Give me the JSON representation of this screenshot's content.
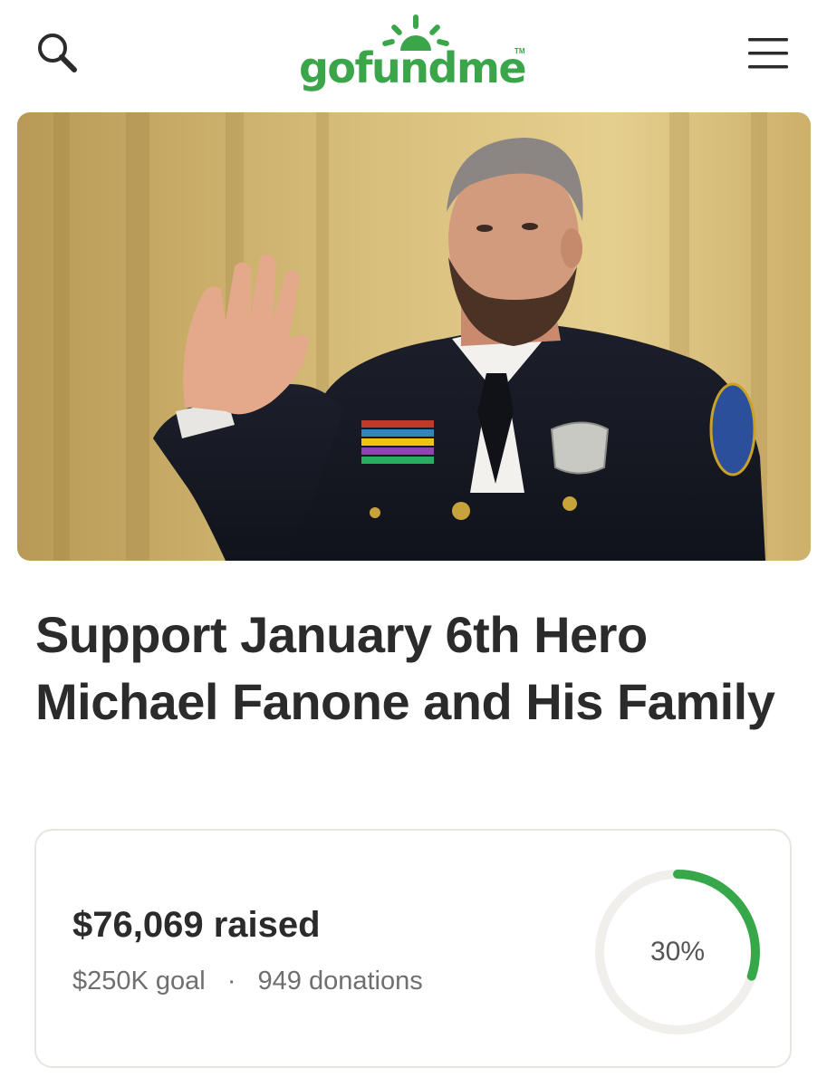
{
  "header": {
    "logo_text": "gofundme",
    "logo_tm": "TM",
    "icons": {
      "search": "search-icon",
      "menu": "hamburger-menu-icon",
      "logo_sun": "sunrise-logo-icon"
    }
  },
  "hero": {
    "image_subject": "police-officer-taking-oath-photo"
  },
  "campaign": {
    "title": "Support January 6th Hero Michael Fanone and His Family"
  },
  "progress": {
    "raised": "$76,069 raised",
    "goal": "$250K goal",
    "separator": "·",
    "donations": "949 donations",
    "percent_label": "30%",
    "fraction": 0.3
  },
  "colors": {
    "brand_green": "#3ba54a",
    "progress_green": "#37a84a",
    "progress_track": "#f0efeb",
    "text_dark": "#2b2b2b",
    "text_muted": "#6f6f6f"
  }
}
